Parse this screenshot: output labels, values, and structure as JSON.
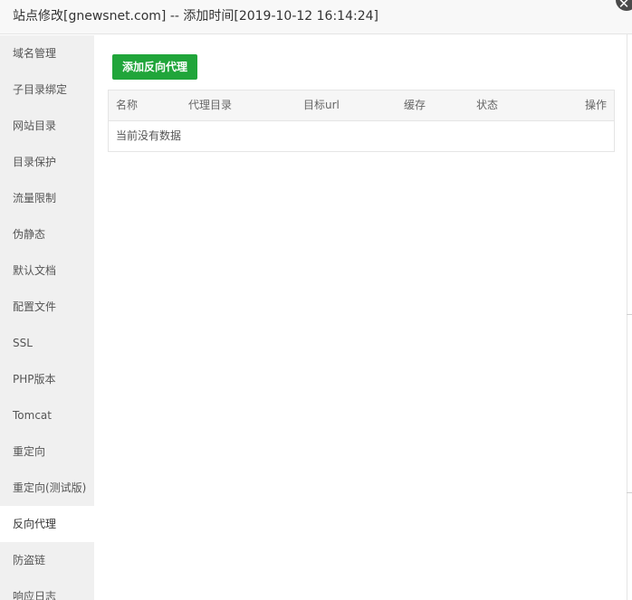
{
  "dialog": {
    "title": "站点修改[gnewsnet.com] -- 添加时间[2019-10-12 16:14:24]",
    "close_glyph": "✕"
  },
  "sidebar": {
    "items": [
      {
        "label": "域名管理"
      },
      {
        "label": "子目录绑定"
      },
      {
        "label": "网站目录"
      },
      {
        "label": "目录保护"
      },
      {
        "label": "流量限制"
      },
      {
        "label": "伪静态"
      },
      {
        "label": "默认文档"
      },
      {
        "label": "配置文件"
      },
      {
        "label": "SSL"
      },
      {
        "label": "PHP版本"
      },
      {
        "label": "Tomcat"
      },
      {
        "label": "重定向"
      },
      {
        "label": "重定向(测试版)"
      },
      {
        "label": "反向代理",
        "active": true
      },
      {
        "label": "防盗链"
      },
      {
        "label": "响应日志"
      }
    ]
  },
  "main": {
    "add_button_label": "添加反向代理",
    "table": {
      "columns": [
        "名称",
        "代理目录",
        "目标url",
        "缓存",
        "状态",
        "操作"
      ],
      "empty_text": "当前没有数据"
    }
  },
  "colors": {
    "accent": "#20a53a",
    "sidebar_bg": "#f0f0f0",
    "active_item_bg": "#ffffff",
    "header_bg": "#f6f6f6"
  }
}
